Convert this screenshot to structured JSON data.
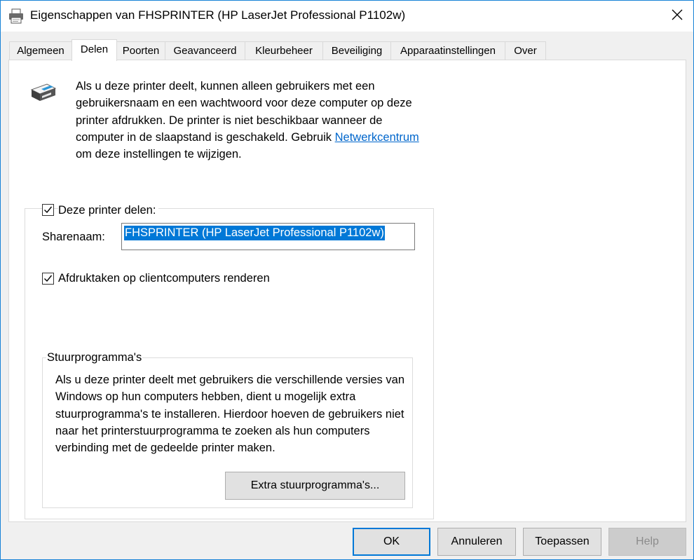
{
  "window": {
    "title": "Eigenschappen van FHSPRINTER (HP LaserJet Professional P1102w)"
  },
  "tabs": [
    {
      "label": "Algemeen"
    },
    {
      "label": "Delen"
    },
    {
      "label": "Poorten"
    },
    {
      "label": "Geavanceerd"
    },
    {
      "label": "Kleurbeheer"
    },
    {
      "label": "Beveiliging"
    },
    {
      "label": "Apparaatinstellingen"
    },
    {
      "label": "Over"
    }
  ],
  "active_tab": "Delen",
  "intro": {
    "text_before_link": "Als u deze printer deelt, kunnen alleen gebruikers met een gebruikersnaam en een wachtwoord voor deze computer op deze printer afdrukken. De printer is niet beschikbaar wanneer de computer in de slaapstand is geschakeld. Gebruik ",
    "link": "Netwerkcentrum",
    "text_after_link": " om deze instellingen te wijzigen."
  },
  "share": {
    "checkbox_label": "Deze printer delen:",
    "checked": true,
    "sharename_label": "Sharenaam:",
    "sharename_value": "FHSPRINTER (HP LaserJet Professional P1102w)",
    "render_label": "Afdruktaken op clientcomputers renderen",
    "render_checked": true
  },
  "drivers": {
    "title": "Stuurprogramma's",
    "text": "Als u deze printer deelt met gebruikers die verschillende versies van Windows op hun computers hebben, dient u mogelijk extra stuurprogramma's te installeren. Hierdoor hoeven de gebruikers niet naar het printerstuurprogramma te zoeken als hun computers verbinding met de gedeelde printer maken.",
    "button": "Extra stuurprogramma's..."
  },
  "buttons": {
    "ok": "OK",
    "cancel": "Annuleren",
    "apply": "Toepassen",
    "help": "Help"
  },
  "colors": {
    "accent": "#0078d7",
    "link": "#0066cc",
    "window_border": "#1883d7"
  }
}
